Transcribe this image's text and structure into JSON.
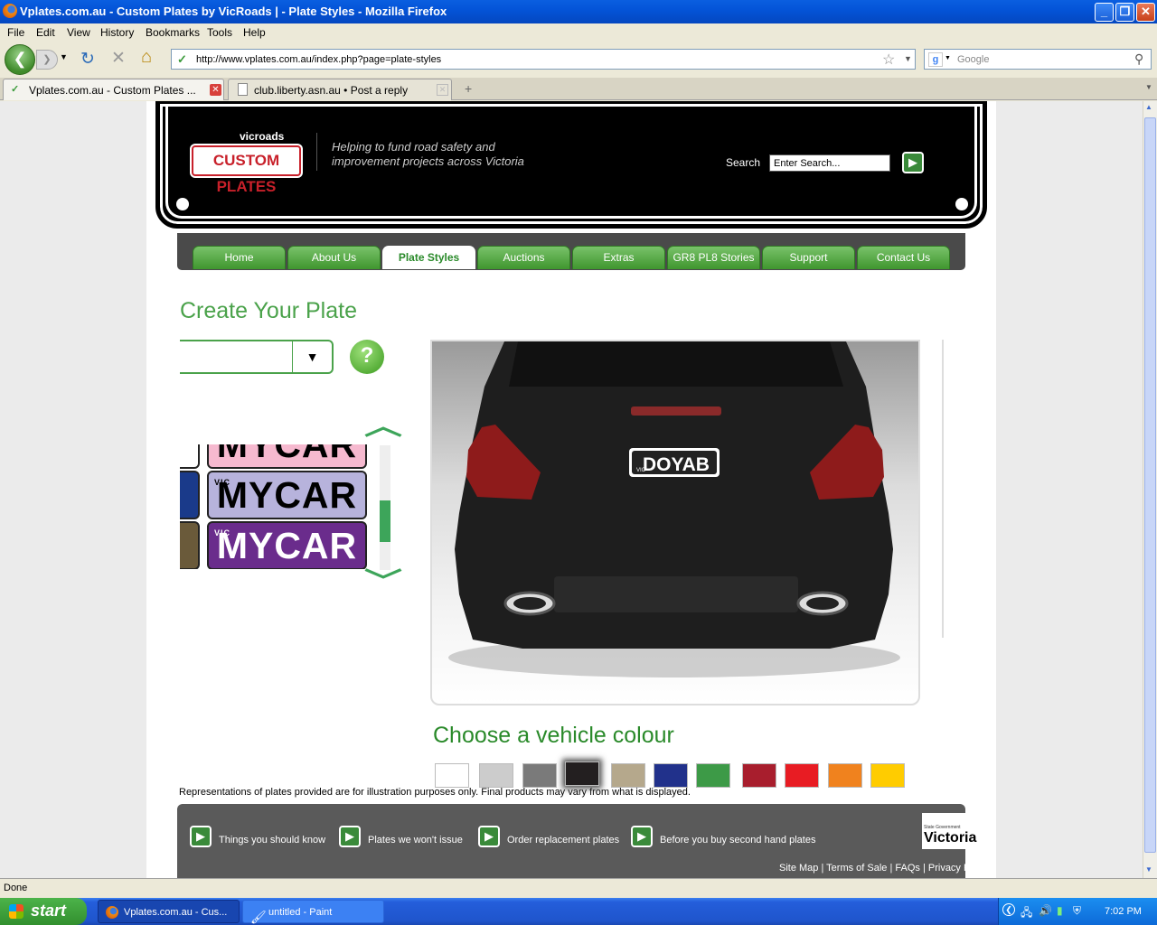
{
  "window": {
    "title": "Vplates.com.au - Custom Plates by VicRoads |  - Plate Styles - Mozilla Firefox"
  },
  "menu": [
    "File",
    "Edit",
    "View",
    "History",
    "Bookmarks",
    "Tools",
    "Help"
  ],
  "address": {
    "url": "http://www.vplates.com.au/index.php?page=plate-styles"
  },
  "search_engine": {
    "placeholder": "Google"
  },
  "tabs": [
    {
      "label": "Vplates.com.au - Custom Plates ..."
    },
    {
      "label": "club.liberty.asn.au • Post a reply"
    }
  ],
  "site": {
    "logo_top": "vicroads",
    "logo_main": "CUSTOM PLATES",
    "tagline": "Helping to fund road safety and improvement projects across Victoria",
    "search_label": "Search",
    "search_value": "Enter Search...",
    "nav": [
      "Home",
      "About Us",
      "Plate Styles",
      "Auctions",
      "Extras",
      "GR8 PL8 Stories",
      "Support",
      "Contact Us"
    ],
    "nav_active": "Plate Styles",
    "create_title": "Create Your Plate",
    "help_symbol": "?",
    "plates": [
      {
        "text": "MYCAR",
        "bg": "#f6b9cf"
      },
      {
        "text": "MYCAR",
        "bg": "#b7b3dc"
      },
      {
        "text": "MYCAR",
        "bg": "#6a2c8c"
      }
    ],
    "plate_state": "VIC",
    "car_plate_text": "DOYAB",
    "colour_title": "Choose a vehicle colour",
    "colours": [
      "#ffffff",
      "#cccccc",
      "#7a7a7a",
      "#231f20",
      "#b5a88c",
      "#21318b",
      "#3d9a47",
      "#a81e2d",
      "#e81c23",
      "#f0821e",
      "#ffcc00"
    ],
    "selected_colour": "#231f20",
    "disclaimer": "Representations of plates provided are for illustration purposes only. Final products may vary from what is displayed.",
    "footer_links": [
      "Things you should know",
      "Plates we won't issue",
      "Order replacement plates",
      "Before you buy second hand plates"
    ],
    "vic_logo_small": "State Government",
    "vic_logo": "Victoria",
    "bottom_links": "Site Map | Terms of Sale | FAQs | Privacy Policy"
  },
  "status": {
    "text": "Done"
  },
  "taskbar": {
    "start": "start",
    "tasks": [
      "Vplates.com.au - Cus...",
      "untitled - Paint"
    ],
    "clock": "7:02 PM"
  }
}
